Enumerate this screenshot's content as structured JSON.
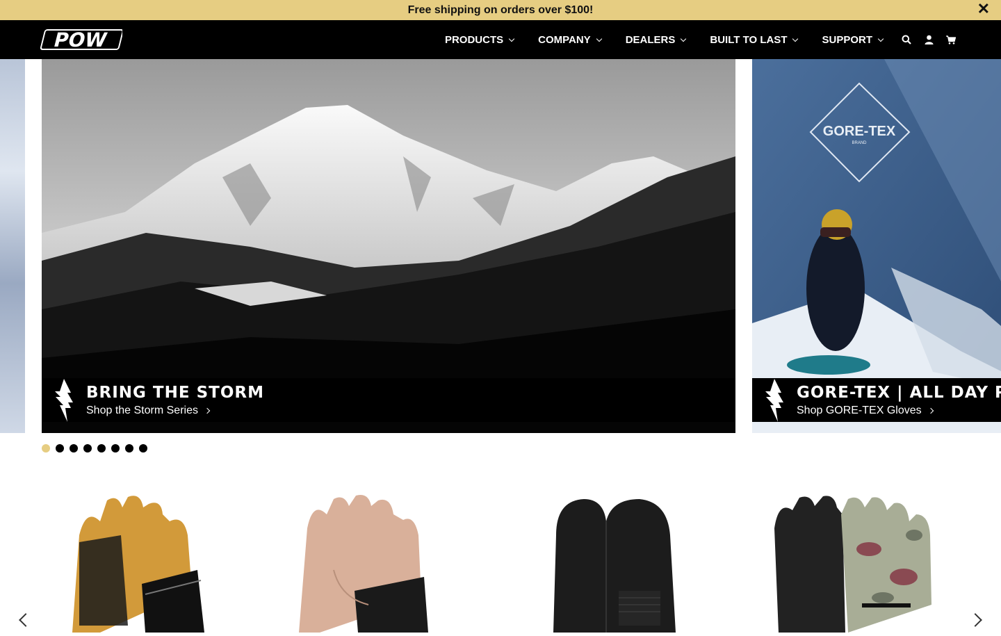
{
  "announcement": {
    "text": "Free shipping on orders over $100!",
    "close_glyph": "✕"
  },
  "brand": {
    "logo_text": "POW"
  },
  "nav": {
    "items": [
      {
        "label": "PRODUCTS"
      },
      {
        "label": "COMPANY"
      },
      {
        "label": "DEALERS"
      },
      {
        "label": "BUILT TO LAST"
      },
      {
        "label": "SUPPORT"
      }
    ],
    "icons": [
      "search-icon",
      "account-icon",
      "cart-icon"
    ]
  },
  "hero": {
    "slides": [
      {
        "title": "BRING THE STORM",
        "link": "Shop the Storm Series"
      },
      {
        "title": "GORE-TEX | ALL DAY P",
        "link": "Shop GORE-TEX Gloves",
        "badge": "GORE-TEX",
        "badge_sub": "BRAND"
      }
    ],
    "dot_count": 8,
    "active_dot": 0
  },
  "products": {
    "items": [
      {
        "name": "tan-leather-glove"
      },
      {
        "name": "pink-leather-glove"
      },
      {
        "name": "black-leather-mitt"
      },
      {
        "name": "camo-glove"
      }
    ]
  },
  "colors": {
    "accent": "#e6cd82",
    "nav_bg": "#000000"
  }
}
